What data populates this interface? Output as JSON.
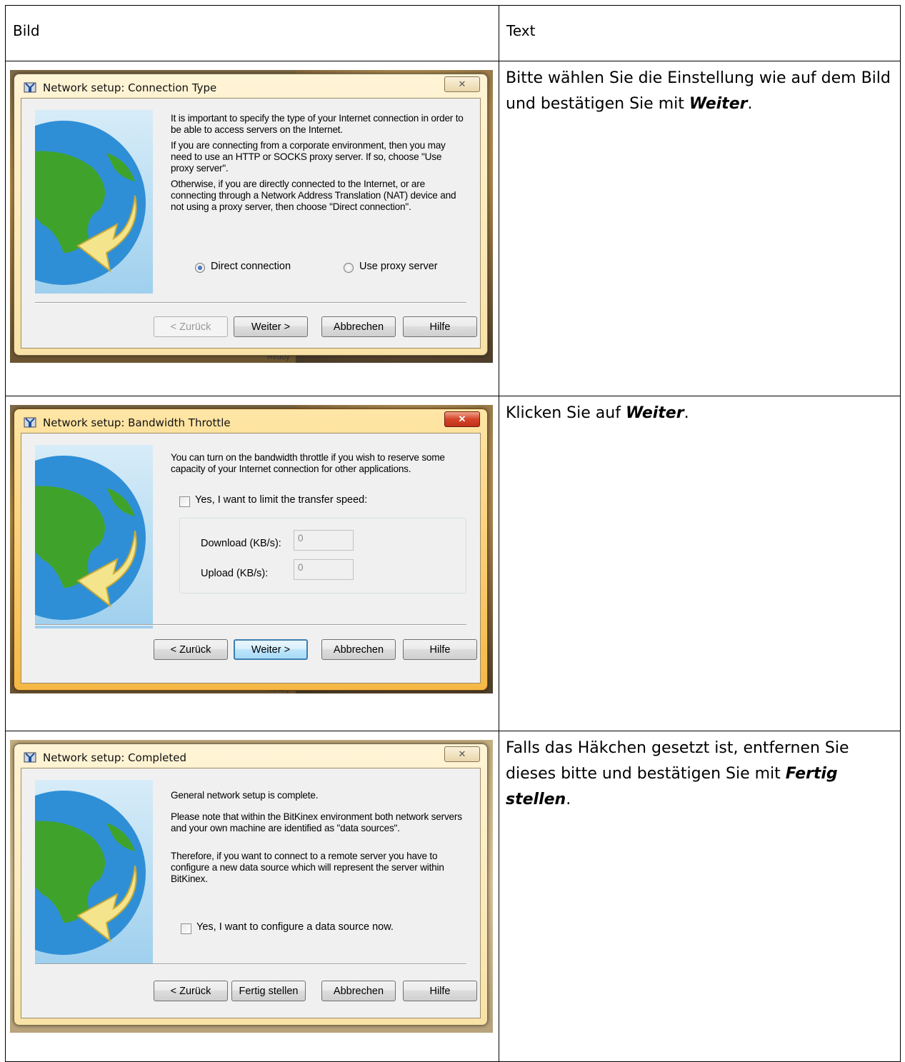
{
  "table": {
    "header_image": "Bild",
    "header_text": "Text"
  },
  "rows": [
    {
      "dialog_title": "Network setup: Connection Type",
      "paragraphs": [
        "It is important to specify the type of your Internet connection in order to be able to access servers on the Internet.",
        "If you are connecting from a corporate environment, then you may need to use an HTTP or SOCKS proxy server. If so, choose \"Use proxy server\".",
        "Otherwise, if you are directly connected to the Internet, or are connecting through a Network Address Translation (NAT) device and not using a proxy server, then choose \"Direct connection\"."
      ],
      "radio_direct": "Direct connection",
      "radio_proxy": "Use proxy server",
      "buttons": {
        "back": "< Zurück",
        "next": "Weiter >",
        "cancel": "Abbrechen",
        "help": "Hilfe"
      },
      "desc_before": "Bitte wählen Sie die Einstellung wie auf dem Bild und bestätigen Sie mit ",
      "desc_bold": "Weiter",
      "desc_after": "."
    },
    {
      "dialog_title": "Network setup: Bandwidth Throttle",
      "paragraphs": [
        "You can turn on the bandwidth throttle if you wish to reserve some capacity of your Internet connection for other applications."
      ],
      "checkbox_label": "Yes, I want to limit the transfer speed:",
      "download_label": "Download (KB/s):",
      "download_value": "0",
      "upload_label": "Upload (KB/s):",
      "upload_value": "0",
      "buttons": {
        "back": "< Zurück",
        "next": "Weiter >",
        "cancel": "Abbrechen",
        "help": "Hilfe"
      },
      "desc_before": "Klicken Sie auf ",
      "desc_bold": "Weiter",
      "desc_after": "."
    },
    {
      "dialog_title": "Network setup: Completed",
      "paragraphs": [
        "General network setup is complete.",
        "Please note that within the BitKinex environment both network servers and your own machine are identified as \"data sources\".",
        "Therefore, if you want to connect to a remote server you have to configure a new data source which will represent the server within BitKinex."
      ],
      "checkbox_label": "Yes, I want to configure a data source now.",
      "buttons": {
        "back": "< Zurück",
        "finish": "Fertig stellen",
        "cancel": "Abbrechen",
        "help": "Hilfe"
      },
      "desc_before": "Falls das Häkchen gesetzt ist, entfernen Sie dieses bitte und bestätigen Sie mit ",
      "desc_bold": "Fertig stellen",
      "desc_after": "."
    }
  ],
  "background_status": "Ready",
  "icons": {
    "close": "close-icon",
    "app": "bitkinex-app-icon",
    "banner": "globe-arrow-icon"
  },
  "colors": {
    "active_close": "#d4452a",
    "default_button_border": "#3c7fb1",
    "banner_blue": "#9fd0ee"
  }
}
